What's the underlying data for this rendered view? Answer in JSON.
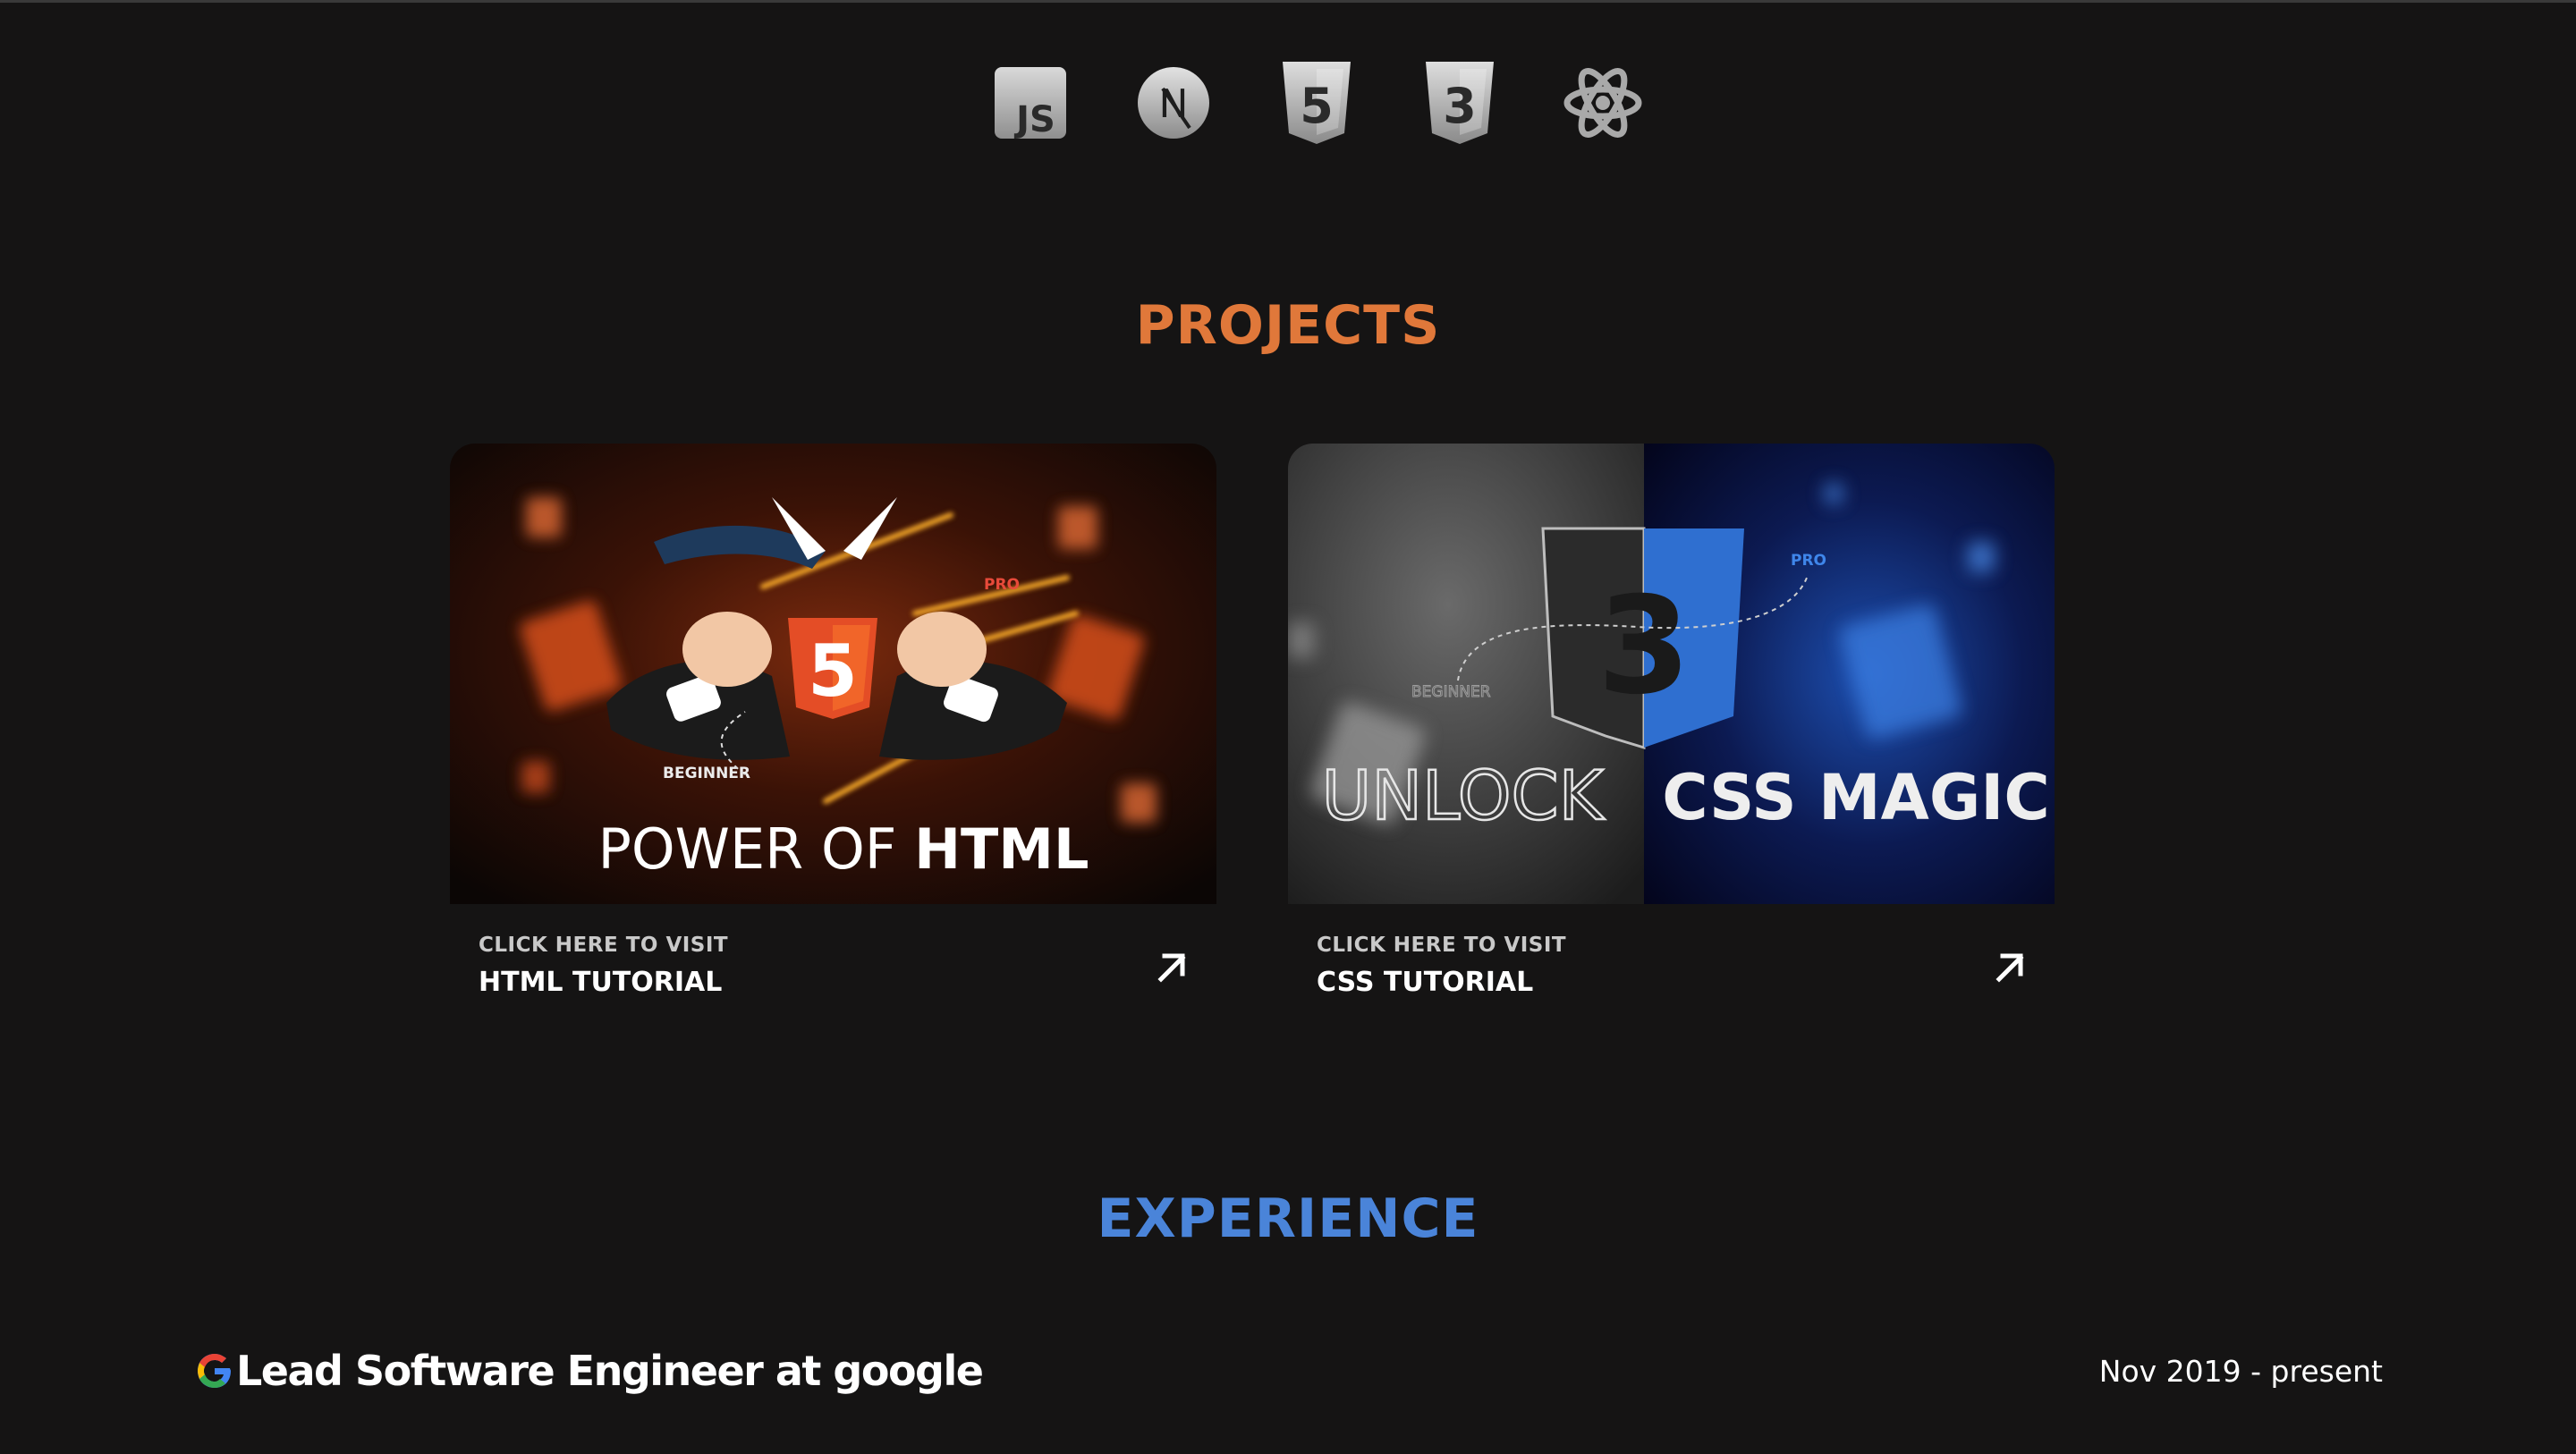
{
  "tech_icons": [
    {
      "name": "javascript-icon",
      "text": "JS"
    },
    {
      "name": "nextjs-icon",
      "text": "N"
    },
    {
      "name": "html5-icon",
      "text": "5"
    },
    {
      "name": "css3-icon",
      "text": "3"
    },
    {
      "name": "react-icon",
      "text": ""
    }
  ],
  "projects": {
    "title": "PROJECTS",
    "items": [
      {
        "kicker": "CLICK HERE TO VISIT",
        "name": "HTML TUTORIAL",
        "thumb_text_light": "POWER OF ",
        "thumb_text_bold": "HTML",
        "thumb_badge_pro": "PRO",
        "thumb_badge_beginner": "BEGINNER",
        "thumb_logo": "5",
        "accent": "#e44d26"
      },
      {
        "kicker": "CLICK HERE TO VISIT",
        "name": "CSS TUTORIAL",
        "thumb_text_light": "UNLOCK",
        "thumb_text_bold": "CSS MAGIC",
        "thumb_badge_pro": "PRO",
        "thumb_badge_beginner": "BEGINNER",
        "thumb_logo": "3",
        "accent": "#2f6fd0"
      }
    ]
  },
  "experience": {
    "title": "EXPERIENCE",
    "items": [
      {
        "role": "Lead Software Engineer at google",
        "date": "Nov 2019 - present"
      }
    ]
  },
  "colors": {
    "background": "#151414",
    "projects_heading": "#e0783a",
    "experience_heading": "#4a84d9"
  }
}
